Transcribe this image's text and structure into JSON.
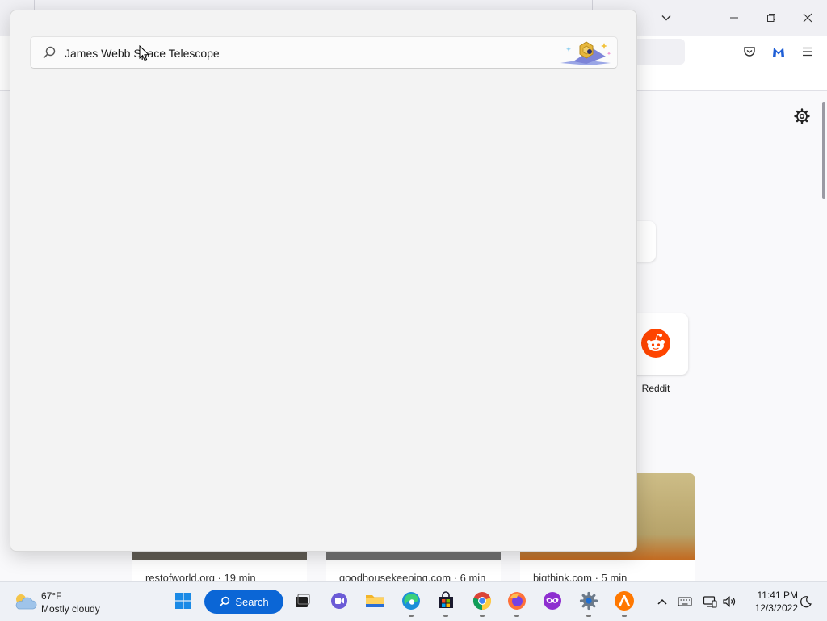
{
  "search": {
    "query": "James Webb Space Telescope",
    "button_label": "Search"
  },
  "newtab": {
    "shortcuts": [
      {
        "label": "Reddit",
        "icon": "reddit-icon"
      }
    ],
    "stories": [
      {
        "source": "restofworld.org · 19 min"
      },
      {
        "source": "goodhousekeeping.com · 6 min"
      },
      {
        "source": "bigthink.com · 5 min"
      }
    ]
  },
  "taskbar": {
    "weather": {
      "temp": "67°F",
      "condition": "Mostly cloudy"
    },
    "clock": {
      "time": "11:41 PM",
      "date": "12/3/2022"
    }
  },
  "colors": {
    "accent": "#0b66d6",
    "reddit": "#ff4500",
    "flyout_bg": "#f3f3f3",
    "taskbar_bg": "#eef1f6"
  }
}
